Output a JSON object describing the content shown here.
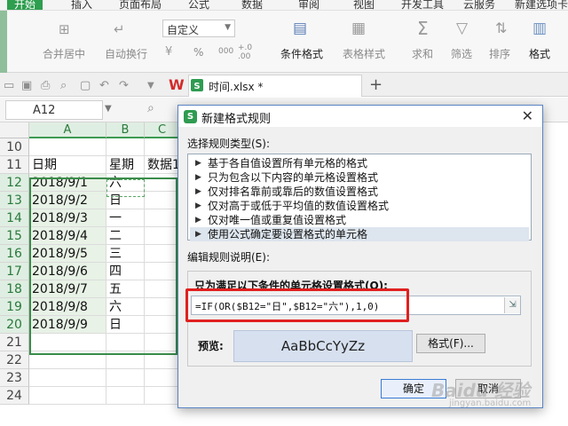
{
  "ribbon_tabs": [
    "开始",
    "插入",
    "页面布局",
    "公式",
    "数据",
    "审阅",
    "视图",
    "开发工具",
    "云服务",
    "新建选项卡"
  ],
  "ribbon": {
    "merge_label": "合并居中",
    "wrap_label": "自动换行",
    "number_format": "自定义",
    "percent": "%",
    "decimals_a": "000",
    "decimals_b": "+.0",
    "decimals_c": ".00",
    "cond_format_label": "条件格式",
    "table_style_label": "表格样式",
    "sum_label": "求和",
    "filter_label": "筛选",
    "sort_label": "排序",
    "format_label": "格式"
  },
  "doc_tab": {
    "name": "时间.xlsx *"
  },
  "formula_bar": {
    "name_box": "A12"
  },
  "sheet": {
    "columns": [
      "A",
      "B",
      "C"
    ],
    "rows": [
      {
        "num": "10",
        "a": "",
        "b": "",
        "c": ""
      },
      {
        "num": "11",
        "a": "日期",
        "b": "星期",
        "c": "数据1"
      },
      {
        "num": "12",
        "a": "2018/9/1",
        "b": "六",
        "c": ""
      },
      {
        "num": "13",
        "a": "2018/9/2",
        "b": "日",
        "c": ""
      },
      {
        "num": "14",
        "a": "2018/9/3",
        "b": "一",
        "c": ""
      },
      {
        "num": "15",
        "a": "2018/9/4",
        "b": "二",
        "c": ""
      },
      {
        "num": "16",
        "a": "2018/9/5",
        "b": "三",
        "c": ""
      },
      {
        "num": "17",
        "a": "2018/9/6",
        "b": "四",
        "c": ""
      },
      {
        "num": "18",
        "a": "2018/9/7",
        "b": "五",
        "c": ""
      },
      {
        "num": "19",
        "a": "2018/9/8",
        "b": "六",
        "c": ""
      },
      {
        "num": "20",
        "a": "2018/9/9",
        "b": "日",
        "c": ""
      },
      {
        "num": "21",
        "a": "",
        "b": "",
        "c": ""
      },
      {
        "num": "22",
        "a": "",
        "b": "",
        "c": ""
      },
      {
        "num": "23",
        "a": "",
        "b": "",
        "c": ""
      },
      {
        "num": "24",
        "a": "",
        "b": "",
        "c": ""
      }
    ]
  },
  "dialog": {
    "title": "新建格式规则",
    "rule_type_label": "选择规则类型(S):",
    "rule_types": [
      "基于各自值设置所有单元格的格式",
      "只为包含以下内容的单元格设置格式",
      "仅对排名靠前或靠后的数值设置格式",
      "仅对高于或低于平均值的数值设置格式",
      "仅对唯一值或重复值设置格式",
      "使用公式确定要设置格式的单元格"
    ],
    "desc_label": "编辑规则说明(E):",
    "formula_label": "只为满足以下条件的单元格设置格式(O):",
    "formula_value": "=IF(OR($B12=\"日\",$B12=\"六\"),1,0)",
    "preview_label": "预览:",
    "preview_text": "AaBbCcYyZz",
    "format_button": "格式(F)...",
    "ok_button": "确定",
    "cancel_button": "取消"
  },
  "watermark": {
    "line1": "Baidu 经验",
    "line2": "jingyan.baidu.com"
  }
}
